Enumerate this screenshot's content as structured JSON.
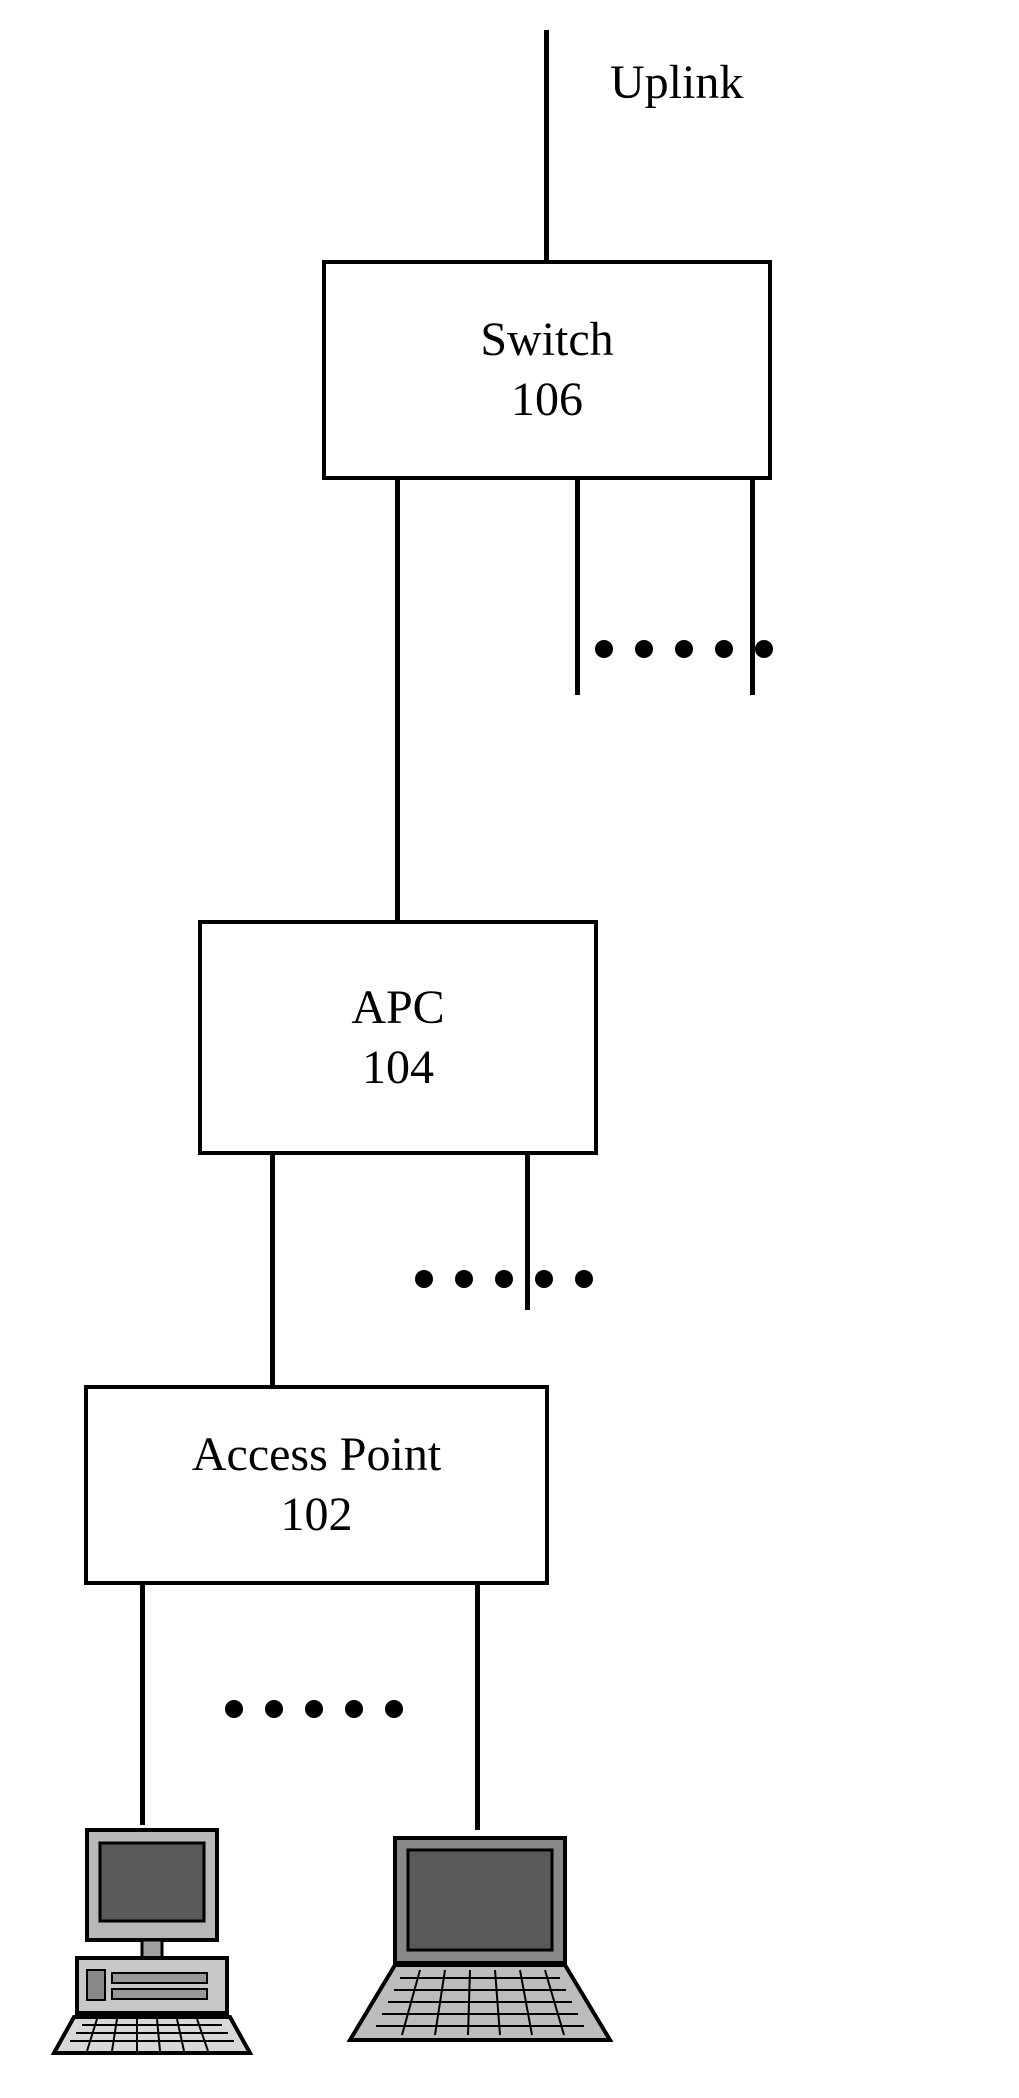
{
  "uplink_label": "Uplink",
  "switch": {
    "name": "Switch",
    "ref": "106"
  },
  "apc": {
    "name": "APC",
    "ref": "104"
  },
  "ap": {
    "name": "Access Point",
    "ref": "102"
  }
}
